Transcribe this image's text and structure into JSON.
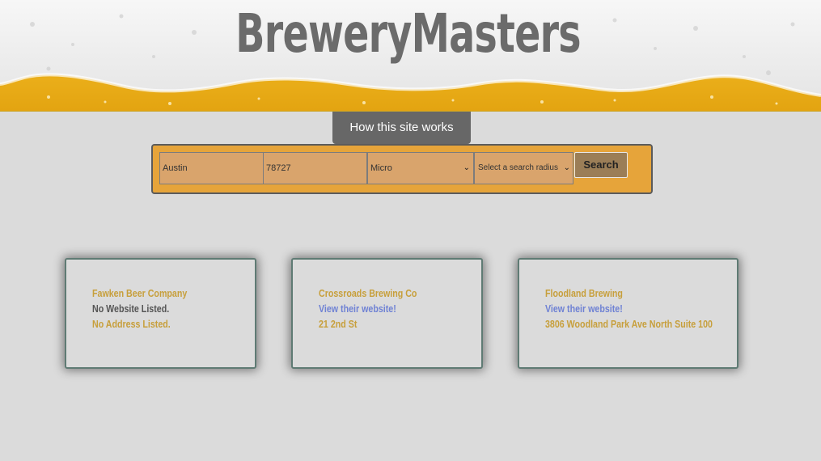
{
  "header": {
    "title": "BreweryMasters"
  },
  "how_button": {
    "label": "How this site works"
  },
  "search": {
    "city_value": "Austin",
    "zip_value": "78727",
    "type_value": "Micro",
    "radius_value": "Select a search radius",
    "button_label": "Search"
  },
  "results": [
    {
      "name": "Fawken Beer Company",
      "website": "No Website Listed.",
      "address": "No Address Listed."
    },
    {
      "name": "Crossroads Brewing Co",
      "website": "View their website!",
      "address": "21 2nd St"
    },
    {
      "name": "Floodland Brewing",
      "website": "View their website!",
      "address": "3806 Woodland Park Ave North Suite 100"
    }
  ],
  "colors": {
    "background": "#dbdbdb",
    "search_bar": "#e6a43a",
    "accent_gold": "#c79f3b",
    "link": "#6f82d4"
  }
}
